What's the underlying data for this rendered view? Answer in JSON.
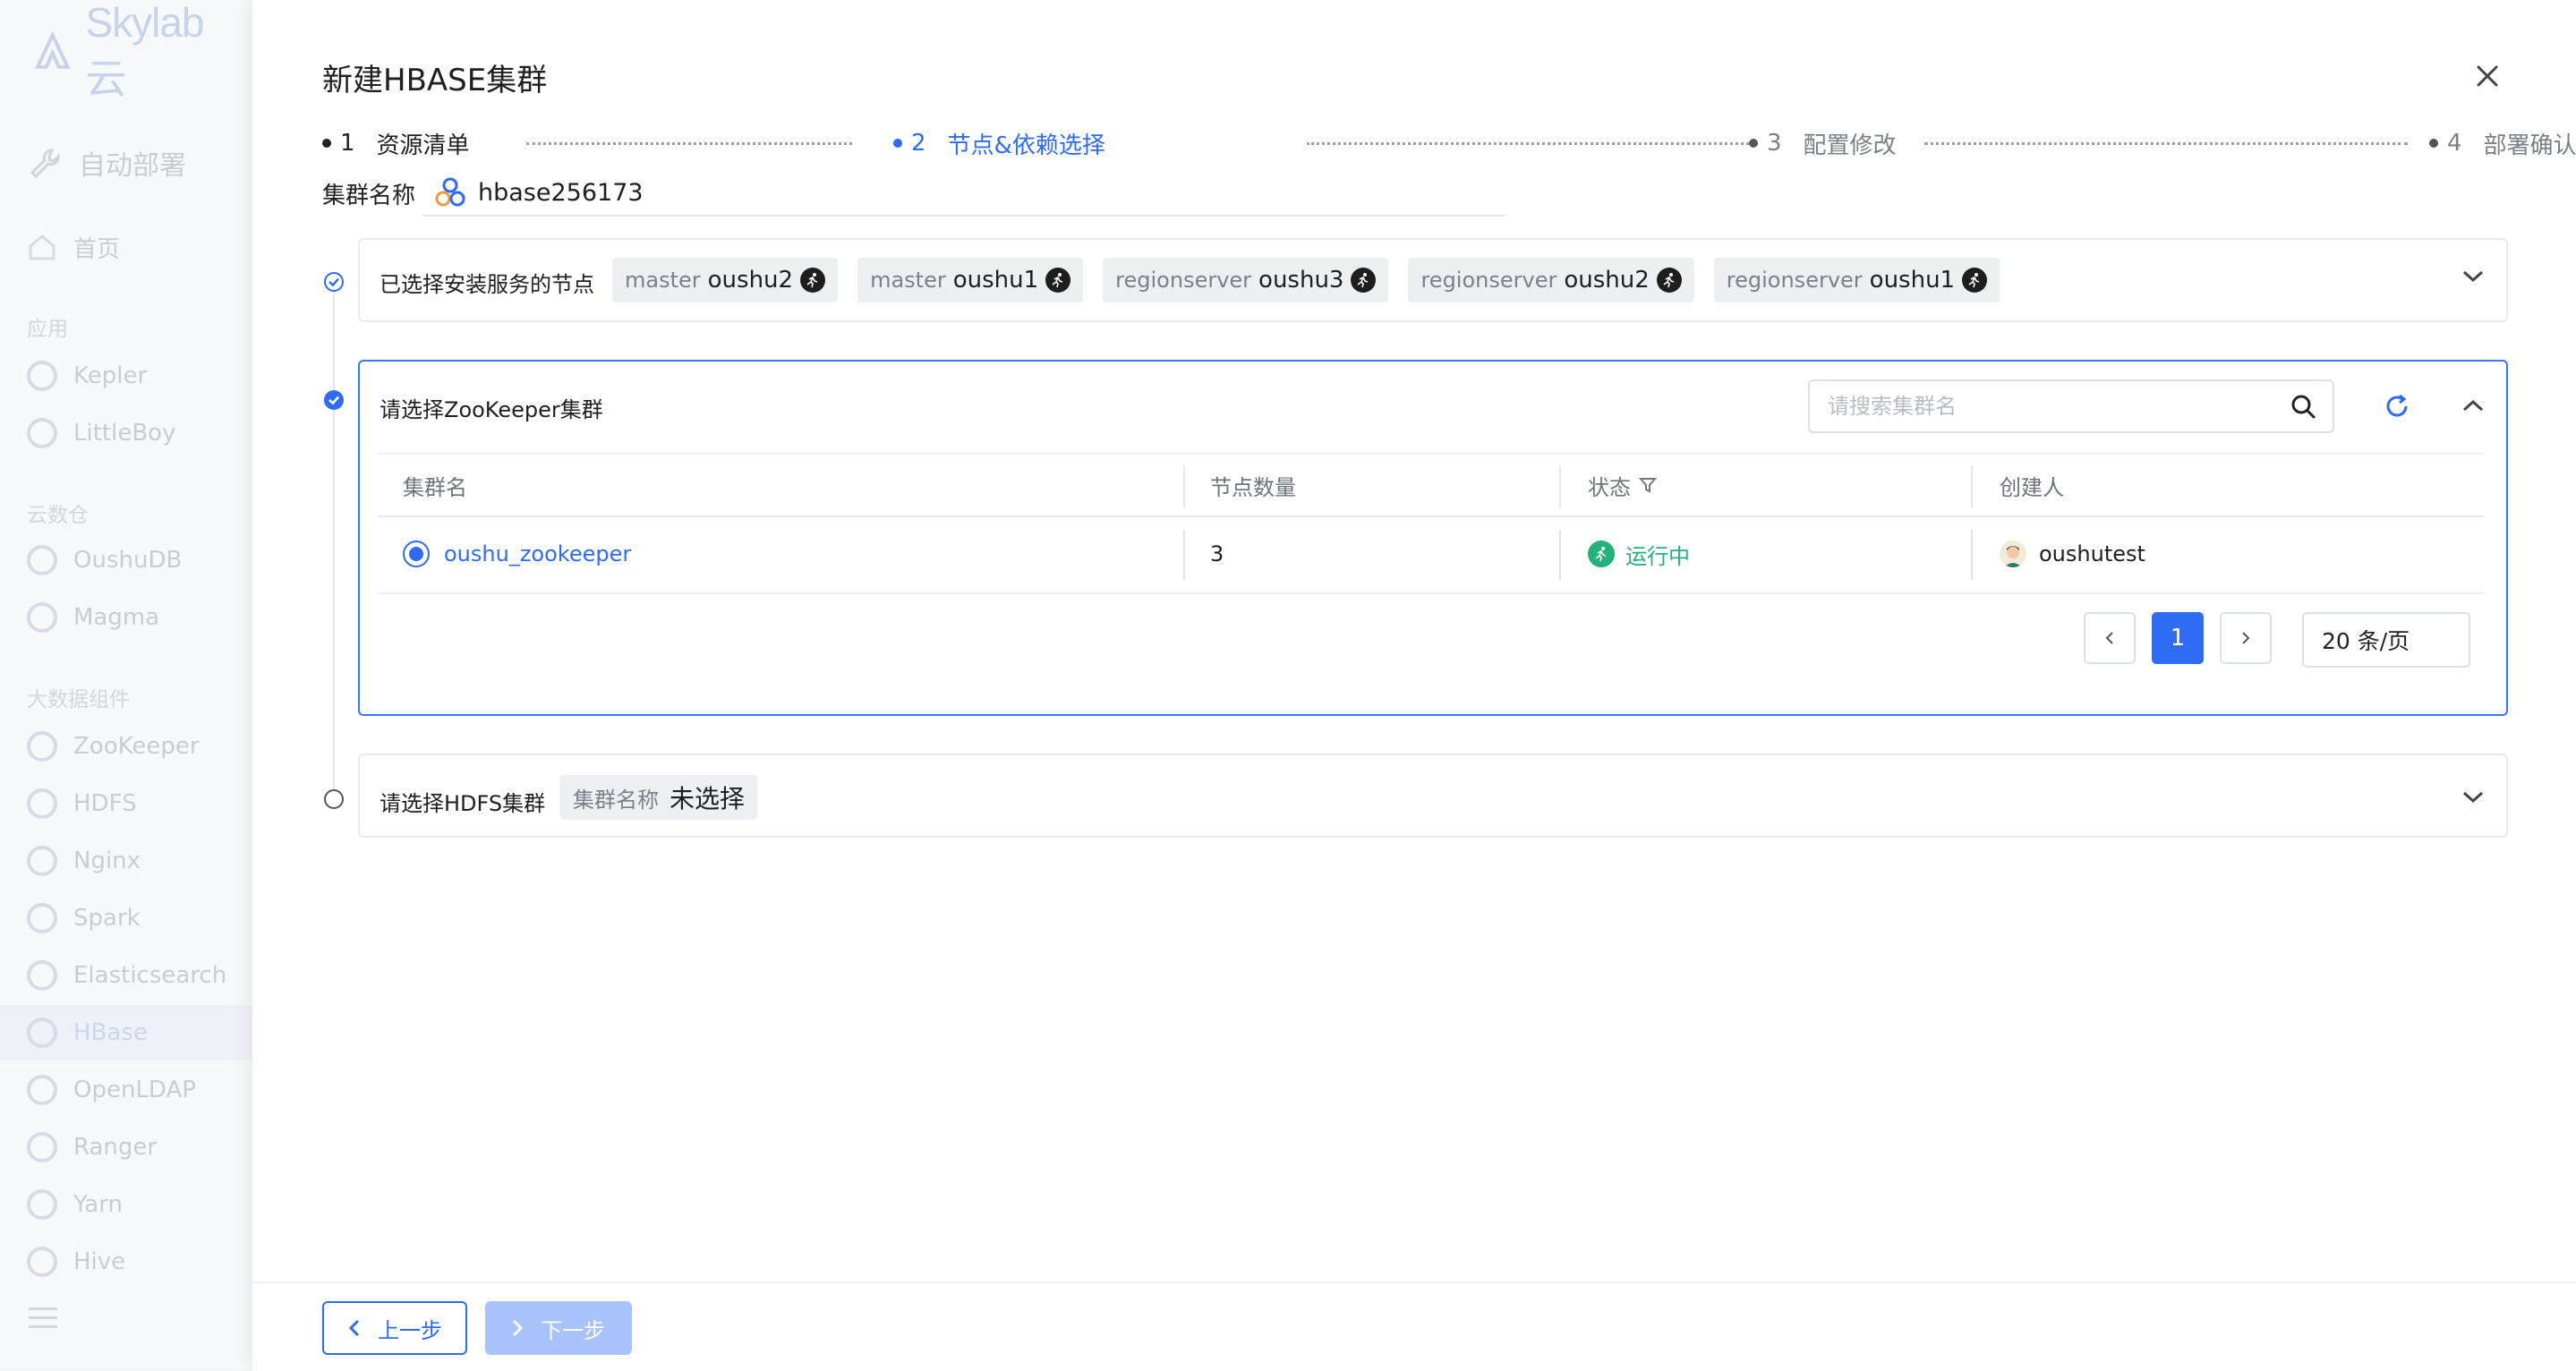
{
  "sidebar": {
    "logo_text": "Skylab 云",
    "top_item": "自动部署",
    "home": "首页",
    "groups": [
      {
        "label": "应用",
        "items": [
          "Kepler",
          "LittleBoy"
        ]
      },
      {
        "label": "云数仓",
        "items": [
          "OushuDB",
          "Magma"
        ]
      },
      {
        "label": "大数据组件",
        "items": [
          "ZooKeeper",
          "HDFS",
          "Nginx",
          "Spark",
          "Elasticsearch",
          "HBase",
          "OpenLDAP",
          "Ranger",
          "Yarn",
          "Hive"
        ]
      }
    ],
    "active_item": "HBase"
  },
  "modal": {
    "title": "新建HBASE集群",
    "steps": [
      {
        "num": "1",
        "label": "资源清单",
        "state": "done"
      },
      {
        "num": "2",
        "label": "节点&依赖选择",
        "state": "active"
      },
      {
        "num": "3",
        "label": "配置修改",
        "state": "pending"
      },
      {
        "num": "4",
        "label": "部署确认",
        "state": "pending"
      }
    ],
    "cluster_name_label": "集群名称",
    "cluster_name_value": "hbase256173"
  },
  "nodes_section": {
    "title": "已选择安装服务的节点",
    "tags": [
      {
        "role": "master",
        "node": "oushu2"
      },
      {
        "role": "master",
        "node": "oushu1"
      },
      {
        "role": "regionserver",
        "node": "oushu3"
      },
      {
        "role": "regionserver",
        "node": "oushu2"
      },
      {
        "role": "regionserver",
        "node": "oushu1"
      }
    ]
  },
  "zk_section": {
    "title": "请选择ZooKeeper集群",
    "search_placeholder": "请搜索集群名",
    "columns": [
      "集群名",
      "节点数量",
      "状态",
      "创建人"
    ],
    "rows": [
      {
        "name": "oushu_zookeeper",
        "nodes": "3",
        "status": "运行中",
        "creator": "oushutest",
        "selected": true
      }
    ],
    "pagination": {
      "current": "1",
      "page_size": "20 条/页"
    }
  },
  "hdfs_section": {
    "title": "请选择HDFS集群",
    "tag_key": "集群名称",
    "tag_value": "未选择"
  },
  "footer": {
    "prev_label": "上一步",
    "next_label": "下一步"
  },
  "colors": {
    "accent": "#2f6cf5",
    "running": "#25b07c",
    "disabled_btn": "#a8c3fb"
  }
}
